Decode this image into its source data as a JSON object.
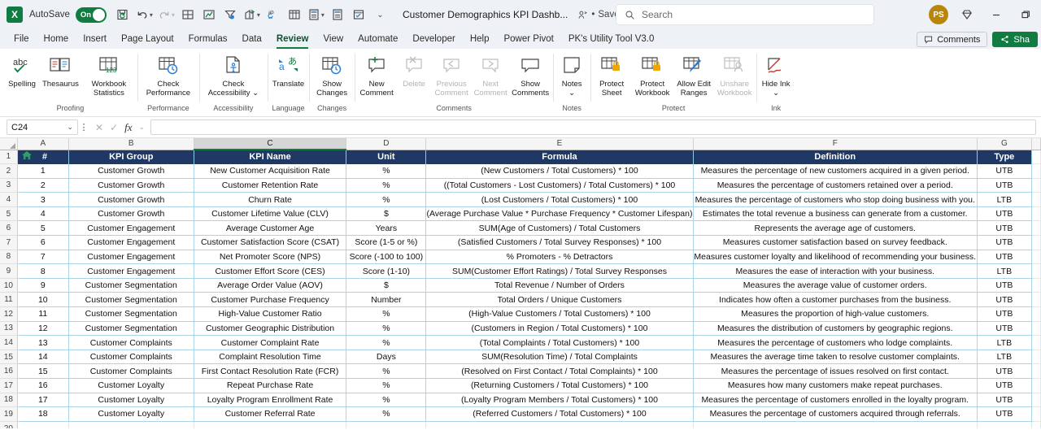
{
  "titlebar": {
    "app_logo": "X",
    "autosave_label": "AutoSave",
    "autosave_state": "On",
    "document_title": "Customer Demographics KPI Dashb...",
    "save_status": "Saved",
    "search_placeholder": "Search",
    "avatar_initials": "PS",
    "quick_access": [
      {
        "name": "save-icon",
        "label": "Save"
      },
      {
        "name": "undo-icon",
        "label": "Undo"
      },
      {
        "name": "redo-icon",
        "label": "Redo"
      },
      {
        "name": "borders-icon",
        "label": "Borders"
      },
      {
        "name": "chart-icon",
        "label": "Chart"
      },
      {
        "name": "filter-icon",
        "label": "Filter"
      },
      {
        "name": "share-export-icon",
        "label": "Export"
      },
      {
        "name": "spelling-icon",
        "label": "Spelling"
      },
      {
        "name": "table-icon",
        "label": "Table"
      },
      {
        "name": "calculator-icon",
        "label": "Calculate"
      },
      {
        "name": "calculator2-icon",
        "label": "Calculate Sheet"
      },
      {
        "name": "form-icon",
        "label": "Form"
      },
      {
        "name": "customize-qat-icon",
        "label": "Customize Quick Access Toolbar"
      }
    ]
  },
  "tabs": [
    {
      "label": "File",
      "active": false
    },
    {
      "label": "Home",
      "active": false
    },
    {
      "label": "Insert",
      "active": false
    },
    {
      "label": "Page Layout",
      "active": false
    },
    {
      "label": "Formulas",
      "active": false
    },
    {
      "label": "Data",
      "active": false
    },
    {
      "label": "Review",
      "active": true
    },
    {
      "label": "View",
      "active": false
    },
    {
      "label": "Automate",
      "active": false
    },
    {
      "label": "Developer",
      "active": false
    },
    {
      "label": "Help",
      "active": false
    },
    {
      "label": "Power Pivot",
      "active": false
    },
    {
      "label": "PK's Utility Tool V3.0",
      "active": false
    }
  ],
  "tabbar_right": {
    "comments_label": "Comments",
    "share_label": "Sha"
  },
  "ribbon": {
    "groups": [
      {
        "name": "Proofing",
        "items": [
          {
            "label": "Spelling",
            "icon": "spelling-abc-icon",
            "disabled": false
          },
          {
            "label": "Thesaurus",
            "icon": "thesaurus-book-icon",
            "disabled": false
          },
          {
            "label": "Workbook Statistics",
            "icon": "workbook-statistics-icon",
            "disabled": false
          }
        ]
      },
      {
        "name": "Performance",
        "items": [
          {
            "label": "Check Performance",
            "icon": "check-performance-icon",
            "disabled": false
          }
        ]
      },
      {
        "name": "Accessibility",
        "items": [
          {
            "label": "Check Accessibility",
            "icon": "check-accessibility-icon",
            "disabled": false,
            "caret": true
          }
        ]
      },
      {
        "name": "Language",
        "items": [
          {
            "label": "Translate",
            "icon": "translate-icon",
            "disabled": false
          }
        ]
      },
      {
        "name": "Changes",
        "items": [
          {
            "label": "Show Changes",
            "icon": "show-changes-icon",
            "disabled": false
          }
        ]
      },
      {
        "name": "Comments",
        "items": [
          {
            "label": "New Comment",
            "icon": "new-comment-icon",
            "disabled": false
          },
          {
            "label": "Delete",
            "icon": "delete-comment-icon",
            "disabled": true
          },
          {
            "label": "Previous Comment",
            "icon": "previous-comment-icon",
            "disabled": true
          },
          {
            "label": "Next Comment",
            "icon": "next-comment-icon",
            "disabled": true
          },
          {
            "label": "Show Comments",
            "icon": "show-comments-icon",
            "disabled": false
          }
        ]
      },
      {
        "name": "Notes",
        "items": [
          {
            "label": "Notes",
            "icon": "notes-icon",
            "disabled": false,
            "caret": true
          }
        ]
      },
      {
        "name": "Protect",
        "items": [
          {
            "label": "Protect Sheet",
            "icon": "protect-sheet-icon",
            "disabled": false
          },
          {
            "label": "Protect Workbook",
            "icon": "protect-workbook-icon",
            "disabled": false
          },
          {
            "label": "Allow Edit Ranges",
            "icon": "allow-edit-ranges-icon",
            "disabled": false
          },
          {
            "label": "Unshare Workbook",
            "icon": "unshare-workbook-icon",
            "disabled": true
          }
        ]
      },
      {
        "name": "Ink",
        "items": [
          {
            "label": "Hide Ink",
            "icon": "hide-ink-icon",
            "disabled": false,
            "caret": true
          }
        ]
      }
    ]
  },
  "formula_bar": {
    "name_box": "C24",
    "formula_value": ""
  },
  "grid": {
    "columns": [
      "A",
      "B",
      "C",
      "D",
      "E",
      "F",
      "G"
    ],
    "selected_column": "C",
    "header_row_number": "1",
    "headers": [
      "#",
      "KPI Group",
      "KPI Name",
      "Unit",
      "Formula",
      "Definition",
      "Type"
    ],
    "row_numbers": [
      "1",
      "2",
      "3",
      "4",
      "5",
      "6",
      "7",
      "8",
      "9",
      "10",
      "11",
      "12",
      "13",
      "14",
      "15",
      "16",
      "17",
      "18",
      "19",
      "20"
    ],
    "rows": [
      {
        "num": "1",
        "group": "Customer Growth",
        "kpi": "New Customer Acquisition Rate",
        "unit": "%",
        "formula": "(New Customers / Total Customers) * 100",
        "definition": "Measures the percentage of new customers acquired in a given period.",
        "type": "UTB"
      },
      {
        "num": "2",
        "group": "Customer Growth",
        "kpi": "Customer Retention Rate",
        "unit": "%",
        "formula": "((Total Customers - Lost Customers) / Total Customers) * 100",
        "definition": "Measures the percentage of customers retained over a period.",
        "type": "UTB"
      },
      {
        "num": "3",
        "group": "Customer Growth",
        "kpi": "Churn Rate",
        "unit": "%",
        "formula": "(Lost Customers / Total Customers) * 100",
        "definition": "Measures the percentage of customers who stop doing business with you.",
        "type": "LTB"
      },
      {
        "num": "4",
        "group": "Customer Growth",
        "kpi": "Customer Lifetime Value (CLV)",
        "unit": "$",
        "formula": "(Average Purchase Value * Purchase Frequency * Customer Lifespan)",
        "definition": "Estimates the total revenue a business can generate from a customer.",
        "type": "UTB"
      },
      {
        "num": "5",
        "group": "Customer Engagement",
        "kpi": "Average Customer Age",
        "unit": "Years",
        "formula": "SUM(Age of Customers) / Total Customers",
        "definition": "Represents the average age of customers.",
        "type": "UTB"
      },
      {
        "num": "6",
        "group": "Customer Engagement",
        "kpi": "Customer Satisfaction Score (CSAT)",
        "unit": "Score (1-5 or %)",
        "formula": "(Satisfied Customers / Total Survey Responses) * 100",
        "definition": "Measures customer satisfaction based on survey feedback.",
        "type": "UTB"
      },
      {
        "num": "7",
        "group": "Customer Engagement",
        "kpi": "Net Promoter Score (NPS)",
        "unit": "Score (-100 to 100)",
        "formula": "% Promoters - % Detractors",
        "definition": "Measures customer loyalty and likelihood of recommending your business.",
        "type": "UTB"
      },
      {
        "num": "8",
        "group": "Customer Engagement",
        "kpi": "Customer Effort Score (CES)",
        "unit": "Score (1-10)",
        "formula": "SUM(Customer Effort Ratings) / Total Survey Responses",
        "definition": "Measures the ease of interaction with your business.",
        "type": "LTB"
      },
      {
        "num": "9",
        "group": "Customer Segmentation",
        "kpi": "Average Order Value (AOV)",
        "unit": "$",
        "formula": "Total Revenue / Number of Orders",
        "definition": "Measures the average value of customer orders.",
        "type": "UTB"
      },
      {
        "num": "10",
        "group": "Customer Segmentation",
        "kpi": "Customer Purchase Frequency",
        "unit": "Number",
        "formula": "Total Orders / Unique Customers",
        "definition": "Indicates how often a customer purchases from the business.",
        "type": "UTB"
      },
      {
        "num": "11",
        "group": "Customer Segmentation",
        "kpi": "High-Value Customer Ratio",
        "unit": "%",
        "formula": "(High-Value Customers / Total Customers) * 100",
        "definition": "Measures the proportion of high-value customers.",
        "type": "UTB"
      },
      {
        "num": "12",
        "group": "Customer Segmentation",
        "kpi": "Customer Geographic Distribution",
        "unit": "%",
        "formula": "(Customers in Region / Total Customers) * 100",
        "definition": "Measures the distribution of customers by geographic regions.",
        "type": "UTB"
      },
      {
        "num": "13",
        "group": "Customer Complaints",
        "kpi": "Customer Complaint Rate",
        "unit": "%",
        "formula": "(Total Complaints / Total Customers) * 100",
        "definition": "Measures the percentage of customers who lodge complaints.",
        "type": "LTB"
      },
      {
        "num": "14",
        "group": "Customer Complaints",
        "kpi": "Complaint Resolution Time",
        "unit": "Days",
        "formula": "SUM(Resolution Time) / Total Complaints",
        "definition": "Measures the average time taken to resolve customer complaints.",
        "type": "LTB"
      },
      {
        "num": "15",
        "group": "Customer Complaints",
        "kpi": "First Contact Resolution Rate (FCR)",
        "unit": "%",
        "formula": "(Resolved on First Contact / Total Complaints) * 100",
        "definition": "Measures the percentage of issues resolved on first contact.",
        "type": "UTB"
      },
      {
        "num": "16",
        "group": "Customer Loyalty",
        "kpi": "Repeat Purchase Rate",
        "unit": "%",
        "formula": "(Returning Customers / Total Customers) * 100",
        "definition": "Measures how many customers make repeat purchases.",
        "type": "UTB"
      },
      {
        "num": "17",
        "group": "Customer Loyalty",
        "kpi": "Loyalty Program Enrollment Rate",
        "unit": "%",
        "formula": "(Loyalty Program Members / Total Customers) * 100",
        "definition": "Measures the percentage of customers enrolled in the loyalty program.",
        "type": "UTB"
      },
      {
        "num": "18",
        "group": "Customer Loyalty",
        "kpi": "Customer Referral Rate",
        "unit": "%",
        "formula": "(Referred Customers / Total Customers) * 100",
        "definition": "Measures the percentage of customers acquired through referrals.",
        "type": "UTB"
      }
    ]
  },
  "colors": {
    "accent_green": "#107c41",
    "header_navy": "#1f3864",
    "grid_border_blue": "#a9d4ea",
    "avatar_gold": "#b8860b"
  }
}
